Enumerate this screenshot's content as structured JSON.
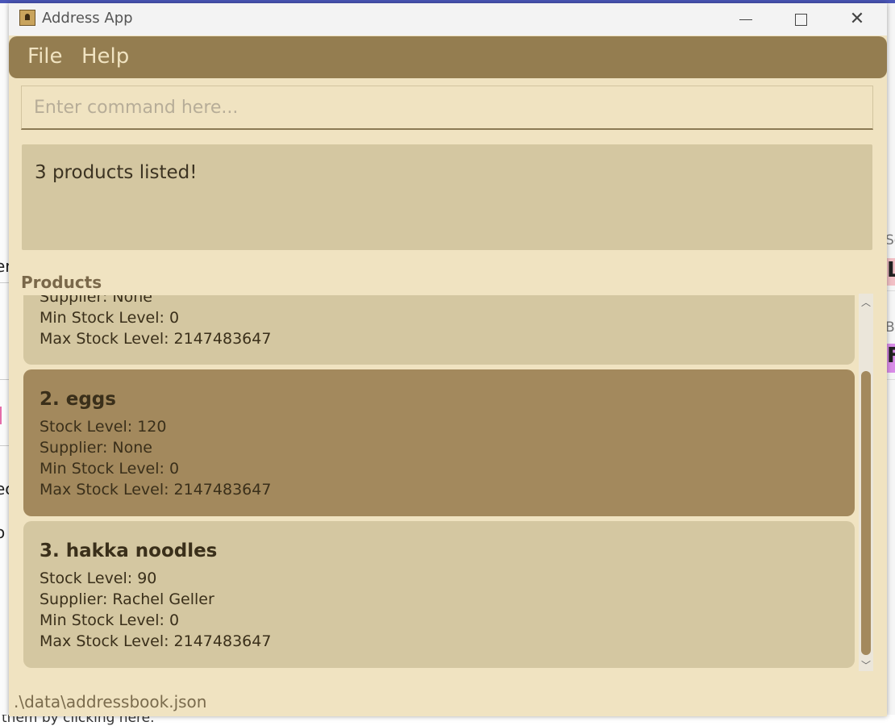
{
  "window": {
    "title": "Address App",
    "icon": "contact-book-icon"
  },
  "menu": {
    "file": "File",
    "help": "Help"
  },
  "command": {
    "placeholder": "Enter command here...",
    "value": ""
  },
  "result": {
    "message": "3 products listed!"
  },
  "products": {
    "label": "Products",
    "items": [
      {
        "name": "",
        "supplier": "Supplier: None",
        "min": "Min Stock Level: 0",
        "max": "Max Stock Level: 2147483647"
      },
      {
        "name": "2. eggs",
        "stock": "Stock Level: 120",
        "supplier": "Supplier: None",
        "min": "Min Stock Level: 0",
        "max": "Max Stock Level: 2147483647"
      },
      {
        "name": "3. hakka noodles",
        "stock": "Stock Level: 90",
        "supplier": "Supplier: Rachel Geller",
        "min": "Min Stock Level: 0",
        "max": "Max Stock Level: 2147483647"
      }
    ]
  },
  "status": {
    "path": ".\\data\\addressbook.json"
  },
  "background": {
    "left_fragments": [
      "er",
      "ec",
      "o"
    ],
    "right_fragments": [
      "Se",
      "L",
      "Bu",
      "F"
    ],
    "bottom_text": "them by clicking here."
  },
  "colors": {
    "window_bg": "#f0e3c1",
    "menubar": "#947d50",
    "card": "#d4c7a1",
    "card_selected": "#a3895d"
  }
}
